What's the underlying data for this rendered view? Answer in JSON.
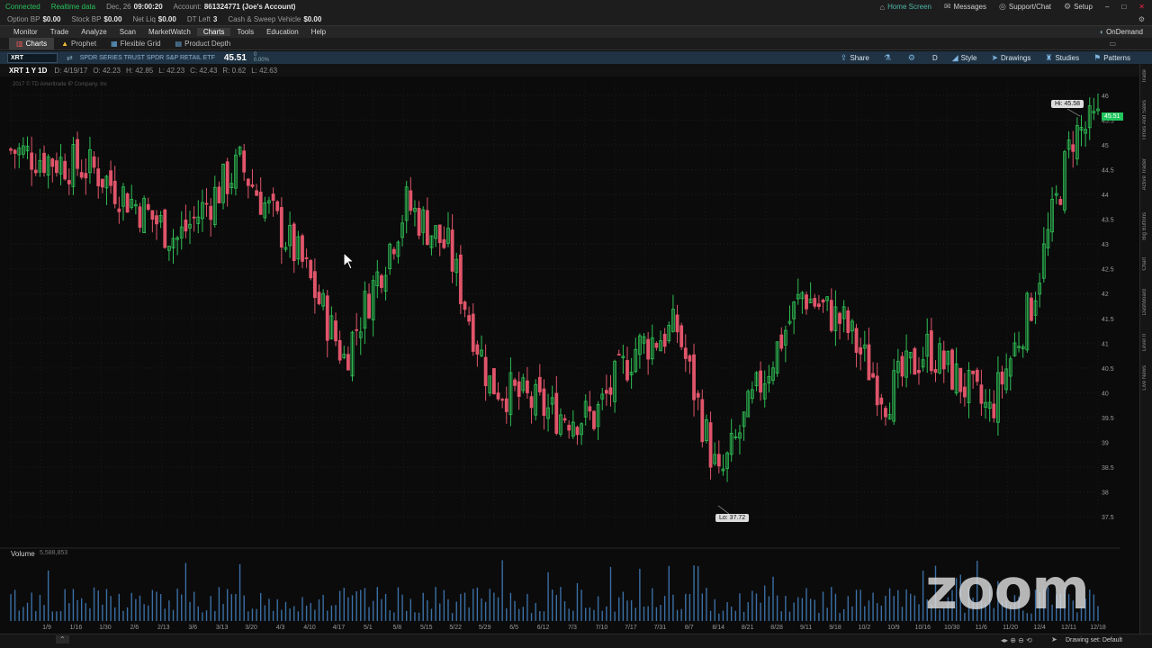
{
  "status": {
    "connected": "Connected",
    "realtime": "Realtime data",
    "date": "Dec, 26",
    "time": "09:00:20",
    "account_label": "Account:",
    "account_value": "861324771 (Joe's Account)",
    "home_screen": "Home Screen",
    "messages": "Messages",
    "support": "Support/Chat",
    "setup": "Setup"
  },
  "account": {
    "option_bp_label": "Option BP",
    "option_bp": "$0.00",
    "stock_bp_label": "Stock BP",
    "stock_bp": "$0.00",
    "net_liq_label": "Net Liq",
    "net_liq": "$0.00",
    "dt_left_label": "DT Left",
    "dt_left": "3",
    "cash_label": "Cash & Sweep Vehicle",
    "cash": "$0.00"
  },
  "menu": {
    "items": [
      "Monitor",
      "Trade",
      "Analyze",
      "Scan",
      "MarketWatch",
      "Charts",
      "Tools",
      "Education",
      "Help"
    ],
    "ondemand": "OnDemand"
  },
  "subtabs": [
    "Charts",
    "Prophet",
    "Flexible Grid",
    "Product Depth"
  ],
  "chart_header": {
    "symbol": "XRT",
    "description": "SPDR SERIES TRUST SPDR S&P RETAIL ETF",
    "price": "45.51",
    "change_top": "0",
    "change_bottom": "0.00%",
    "tools": [
      "Share",
      "D",
      "Style",
      "Drawings",
      "Studies",
      "Patterns"
    ]
  },
  "ohlc": {
    "symbol_period": "XRT 1 Y 1D",
    "d": "D: 4/19/17",
    "o": "O: 42.23",
    "h": "H: 42.85",
    "l": "L: 42.23",
    "c": "C: 42.43",
    "r": "R: 0.62",
    "extra": "L: 42.63"
  },
  "copyright": "2017 © TD Ameritrade IP Company, Inc",
  "hi_label": "Hi: 45.58",
  "lo_label": "Lo: 37.72",
  "last_label": "45.51",
  "volume": {
    "title": "Volume",
    "value": "5,588,853"
  },
  "sidebar_labels": [
    "Trade",
    "Times And Sales",
    "Active Trader",
    "Big Buttons",
    "Chart",
    "Dashboard",
    "Level II",
    "Live News"
  ],
  "bottom": {
    "drawing_set": "Drawing set: Default"
  },
  "zoom_logo": "zoom",
  "chart_data": {
    "type": "candlestick",
    "y_ticks": [
      "46",
      "45.5",
      "45",
      "44.5",
      "44",
      "43.5",
      "43",
      "42.5",
      "42",
      "41.5",
      "41",
      "40.5",
      "40",
      "39.5",
      "39",
      "38.5",
      "38",
      "37.5"
    ],
    "ylim": [
      37.3,
      46.2
    ],
    "x_ticks": [
      "1/9",
      "1/16",
      "1/30",
      "2/6",
      "2/13",
      "3/6",
      "3/13",
      "3/20",
      "4/3",
      "4/10",
      "4/17",
      "5/1",
      "5/8",
      "5/15",
      "5/22",
      "5/29",
      "6/5",
      "6/12",
      "7/3",
      "7/10",
      "7/17",
      "7/31",
      "8/7",
      "8/14",
      "8/21",
      "8/28",
      "9/11",
      "9/18",
      "10/2",
      "10/9",
      "10/16",
      "10/30",
      "11/6",
      "11/20",
      "12/4",
      "12/11",
      "12/18"
    ],
    "trend": [
      [
        0,
        44.9
      ],
      [
        20,
        44.5
      ],
      [
        40,
        43.1
      ],
      [
        55,
        44.6
      ],
      [
        70,
        42.6
      ],
      [
        80,
        40.7
      ],
      [
        95,
        43.8
      ],
      [
        105,
        42.9
      ],
      [
        115,
        40.2
      ],
      [
        130,
        39.6
      ],
      [
        140,
        39.5
      ],
      [
        150,
        40.9
      ],
      [
        160,
        41.3
      ],
      [
        170,
        38.2
      ],
      [
        180,
        40.2
      ],
      [
        190,
        42.0
      ],
      [
        200,
        41.4
      ],
      [
        210,
        39.9
      ],
      [
        220,
        40.9
      ],
      [
        235,
        39.6
      ],
      [
        245,
        41.8
      ],
      [
        255,
        45.2
      ],
      [
        262,
        45.5
      ]
    ],
    "hi": 45.58,
    "lo": 37.72,
    "last": 45.51
  }
}
